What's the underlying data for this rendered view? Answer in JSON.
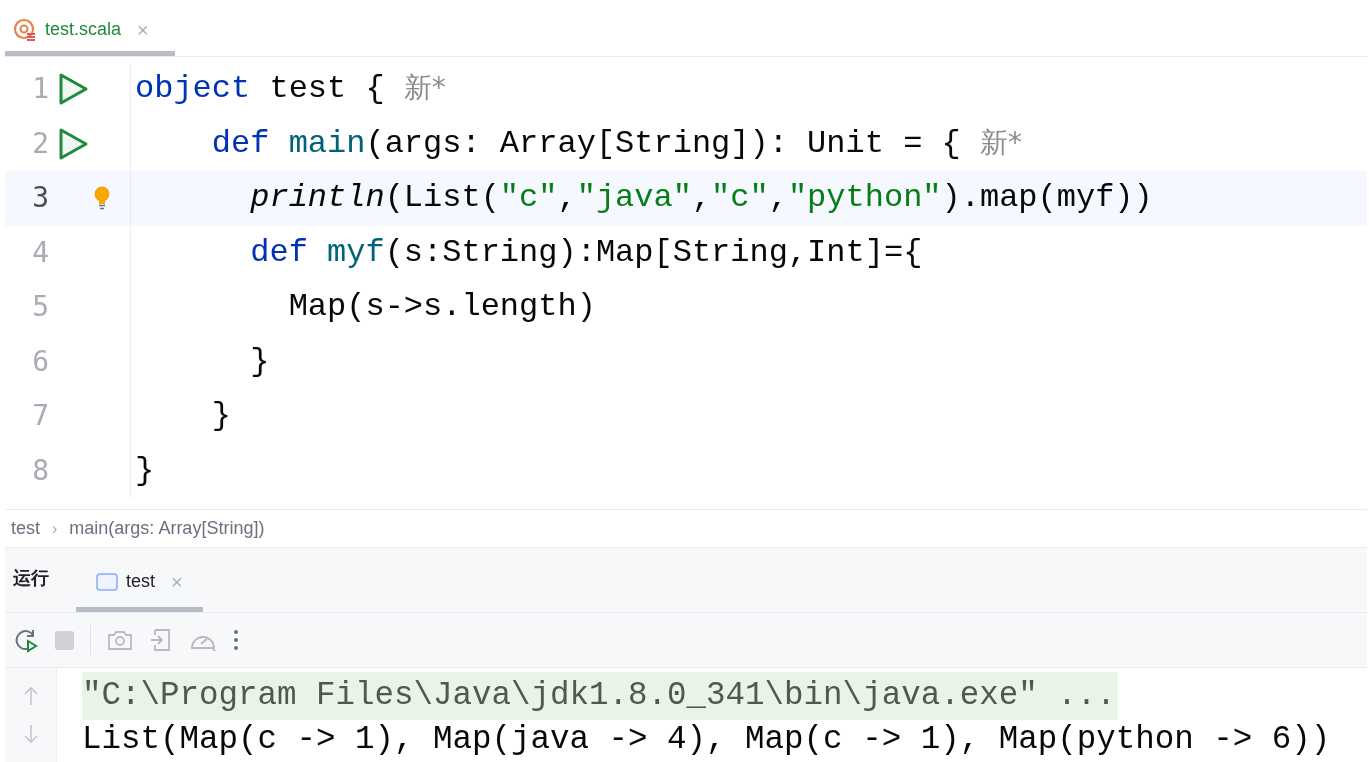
{
  "editor_tabs": [
    {
      "label": "test.scala",
      "close": "×",
      "selected": true
    }
  ],
  "code_lines": [
    {
      "number": "1",
      "runnable": true,
      "bulb": false,
      "current": false,
      "tokens": [
        {
          "kind": "keyword",
          "text": "object"
        },
        {
          "kind": "plain",
          "text": " test { "
        },
        {
          "kind": "hint",
          "text": "新*"
        }
      ]
    },
    {
      "number": "2",
      "runnable": true,
      "bulb": false,
      "current": false,
      "tokens": [
        {
          "kind": "keyword",
          "text": "    def "
        },
        {
          "kind": "function",
          "text": "main"
        },
        {
          "kind": "plain",
          "text": "(args: Array[String]): Unit = { "
        },
        {
          "kind": "hint",
          "text": "新*"
        }
      ]
    },
    {
      "number": "3",
      "runnable": false,
      "bulb": true,
      "current": true,
      "tokens": [
        {
          "kind": "italic",
          "text": "      println"
        },
        {
          "kind": "plain",
          "text": "(List("
        },
        {
          "kind": "string",
          "text": "\"c\""
        },
        {
          "kind": "plain",
          "text": ","
        },
        {
          "kind": "string",
          "text": "\"java\""
        },
        {
          "kind": "plain",
          "text": ","
        },
        {
          "kind": "string",
          "text": "\"c\""
        },
        {
          "kind": "plain",
          "text": ","
        },
        {
          "kind": "string",
          "text": "\"python\""
        },
        {
          "kind": "plain",
          "text": ").map(myf))"
        }
      ]
    },
    {
      "number": "4",
      "runnable": false,
      "bulb": false,
      "current": false,
      "tokens": [
        {
          "kind": "keyword",
          "text": "      def "
        },
        {
          "kind": "function",
          "text": "myf"
        },
        {
          "kind": "plain",
          "text": "(s:String):Map[String,Int]={"
        }
      ]
    },
    {
      "number": "5",
      "runnable": false,
      "bulb": false,
      "current": false,
      "tokens": [
        {
          "kind": "plain",
          "text": "        Map(s->s.length)"
        }
      ]
    },
    {
      "number": "6",
      "runnable": false,
      "bulb": false,
      "current": false,
      "tokens": [
        {
          "kind": "plain",
          "text": "      }"
        }
      ]
    },
    {
      "number": "7",
      "runnable": false,
      "bulb": false,
      "current": false,
      "tokens": [
        {
          "kind": "plain",
          "text": "    }"
        }
      ]
    },
    {
      "number": "8",
      "runnable": false,
      "bulb": false,
      "current": false,
      "tokens": [
        {
          "kind": "plain",
          "text": "}"
        }
      ]
    }
  ],
  "breadcrumbs": {
    "separator": "›",
    "items": [
      "test",
      "main(args: Array[String])"
    ]
  },
  "run_panel": {
    "title": "运行",
    "tabs": [
      {
        "label": "test",
        "close": "×",
        "selected": true
      }
    ],
    "console": [
      {
        "kind": "command",
        "text": "\"C:\\Program Files\\Java\\jdk1.8.0_341\\bin\\java.exe\" ..."
      },
      {
        "kind": "output",
        "text": "List(Map(c -> 1), Map(java -> 4), Map(c -> 1), Map(python -> 6))"
      }
    ]
  }
}
